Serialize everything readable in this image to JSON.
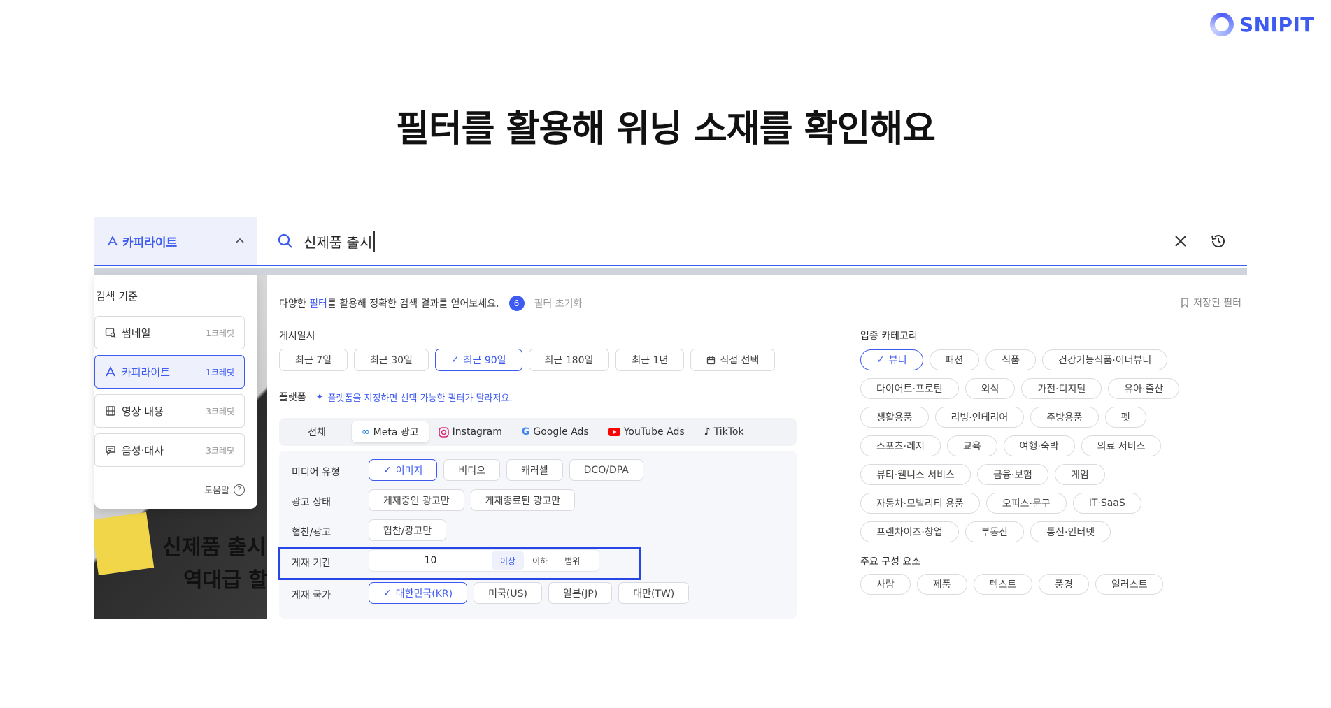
{
  "brand": {
    "name": "SNIPIT"
  },
  "headline": "필터를 활용해 위닝 소재를 확인해요",
  "search": {
    "mode_label": "카피라이트",
    "value": "신제품 출시"
  },
  "background_preview": {
    "line1": "신제품 출시",
    "line2": "역대급 할인"
  },
  "criteria": {
    "title": "검색 기준",
    "items": [
      {
        "label": "썸네일",
        "credit": "1크레딧",
        "icon": "image-search-icon"
      },
      {
        "label": "카피라이트",
        "credit": "1크레딧",
        "icon": "copyright-a-icon",
        "active": true
      },
      {
        "label": "영상 내용",
        "credit": "3크레딧",
        "icon": "film-icon"
      },
      {
        "label": "음성·대사",
        "credit": "3크레딧",
        "icon": "speech-bubble-icon"
      }
    ],
    "help": "도움말"
  },
  "filters": {
    "intro_prefix": "다양한 ",
    "intro_accent": "필터",
    "intro_suffix": "를 활용해 정확한 검색 결과를 얻어보세요.",
    "count": "6",
    "reset": "필터 초기화",
    "saved": "저장된 필터",
    "posted": {
      "label": "게시일시",
      "options": [
        "최근 7일",
        "최근 30일",
        "최근 90일",
        "최근 180일",
        "최근 1년",
        "직접 선택"
      ],
      "selected_index": 2
    },
    "platform": {
      "label": "플랫폼",
      "hint": "플랫폼을 지정하면 선택 가능한 필터가 달라져요.",
      "tabs": [
        "전체",
        "Meta 광고",
        "Instagram",
        "Google Ads",
        "YouTube Ads",
        "TikTok"
      ],
      "selected_index": 1
    },
    "media_type": {
      "label": "미디어 유형",
      "options": [
        "이미지",
        "비디오",
        "캐러셀",
        "DCO/DPA"
      ],
      "selected_index": 0
    },
    "ad_status": {
      "label": "광고 상태",
      "options": [
        "게재중인 광고만",
        "게재종료된 광고만"
      ]
    },
    "sponsored": {
      "label": "협찬/광고",
      "options": [
        "협찬/광고만"
      ]
    },
    "period": {
      "label": "게재 기간",
      "value": "10",
      "options": [
        "이상",
        "이하",
        "범위"
      ],
      "selected_index": 0
    },
    "country": {
      "label": "게재 국가",
      "options": [
        "대한민국(KR)",
        "미국(US)",
        "일본(JP)",
        "대만(TW)"
      ],
      "selected_index": 0
    },
    "industry": {
      "label": "업종 카테고리",
      "rows": [
        [
          "뷰티",
          "패션",
          "식품",
          "건강기능식품·이너뷰티"
        ],
        [
          "다이어트·프로틴",
          "외식",
          "가전·디지털",
          "유아·출산"
        ],
        [
          "생활용품",
          "리빙·인테리어",
          "주방용품",
          "펫"
        ],
        [
          "스포츠·레저",
          "교육",
          "여행·숙박",
          "의료 서비스"
        ],
        [
          "뷰티·웰니스 서비스",
          "금융·보험",
          "게임"
        ],
        [
          "자동차·모빌리티 용품",
          "오피스·문구",
          "IT·SaaS"
        ],
        [
          "프랜차이즈·창업",
          "부동산",
          "통신·인터넷"
        ]
      ]
    },
    "components": {
      "label": "주요 구성 요소",
      "options": [
        "사람",
        "제품",
        "텍스트",
        "풍경",
        "일러스트"
      ]
    }
  },
  "colors": {
    "accent": "#3d5af1",
    "highlight": "#2746e5"
  }
}
